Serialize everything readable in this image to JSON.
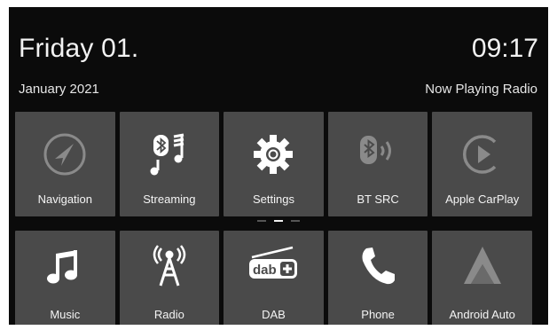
{
  "header": {
    "day": "Friday 01.",
    "time": "09:17",
    "date": "January 2021",
    "now_playing": "Now Playing Radio"
  },
  "tiles_row1": [
    {
      "label": "Navigation",
      "icon": "navigation-icon"
    },
    {
      "label": "Streaming",
      "icon": "bluetooth-music-icon"
    },
    {
      "label": "Settings",
      "icon": "gear-icon"
    },
    {
      "label": "BT SRC",
      "icon": "bluetooth-speaker-icon"
    },
    {
      "label": "Apple CarPlay",
      "icon": "carplay-icon"
    }
  ],
  "tiles_row2": [
    {
      "label": "Music",
      "icon": "music-note-icon"
    },
    {
      "label": "Radio",
      "icon": "radio-tower-icon"
    },
    {
      "label": "DAB",
      "icon": "dab-icon"
    },
    {
      "label": "Phone",
      "icon": "phone-icon"
    },
    {
      "label": "Android Auto",
      "icon": "android-auto-icon"
    }
  ],
  "pager": {
    "pages": 3,
    "active": 2
  },
  "colors": {
    "background": "#0b0b0b",
    "tile": "#4a4a4a",
    "text": "#f2f2f2",
    "icon_dim": "#8a8a8a"
  }
}
